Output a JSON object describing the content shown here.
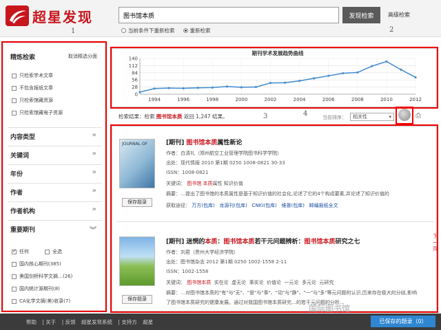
{
  "header": {
    "logo_text": "超星发现",
    "search_value": "图书馆本质",
    "search_button": "发现检索",
    "advanced_link": "高级检索",
    "radio_options": [
      {
        "label": "当前条件下重新检索",
        "checked": false
      },
      {
        "label": "重新检索",
        "checked": true
      }
    ]
  },
  "annotations": [
    "1",
    "2",
    "3",
    "4"
  ],
  "sidebar": {
    "title": "精炼检索",
    "cancel": "取消精选分面",
    "options": [
      "只检索学术文章",
      "不包含报纸文章",
      "只检索馆藏资源",
      "只检索馆藏电子资源"
    ],
    "sections": [
      "内容类型",
      "关键词",
      "年份",
      "作者",
      "作者机构"
    ],
    "core_journals": {
      "title": "重要期刊",
      "any": "任何",
      "all": "全选",
      "items": [
        "国内核心期刊(385)",
        "美国剑桥科学文摘…(26)",
        "国内统计源期刊(8)",
        "CA化学文摘(美)收录(7)"
      ]
    }
  },
  "chart_data": {
    "type": "line",
    "title": "期刊学术发展趋势曲线",
    "x": [
      1993,
      1994,
      1995,
      1996,
      1997,
      1998,
      1999,
      2000,
      2001,
      2002,
      2003,
      2004,
      2005,
      2006,
      2007,
      2008,
      2009,
      2010,
      2011,
      2012
    ],
    "series": [
      {
        "values": [
          8,
          22,
          24,
          23,
          25,
          26,
          30,
          27,
          28,
          44,
          45,
          52,
          62,
          72,
          82,
          85,
          110,
          128,
          96,
          66
        ]
      }
    ],
    "yticks": [
      0,
      28,
      56,
      84,
      112,
      140
    ],
    "xticks": [
      "1994",
      "1996",
      "1998",
      "2000",
      "2002",
      "2004",
      "2006",
      "2008",
      "2010",
      "2012"
    ],
    "ylim": [
      0,
      140
    ],
    "grid": true,
    "color": "#4a90d0"
  },
  "results": {
    "prefix": "检索结果：检索",
    "keyword": "图书馆本质",
    "count_text": "返回 1,247 结果",
    "suffix": "。",
    "sort_label": "当前排序：",
    "sort_value": "相关性"
  },
  "items": [
    {
      "type": "[期刊]",
      "title_hl": "图书馆本质",
      "title_rest": "属性新论",
      "author": "作者：白清礼（郑州航空工业管理学院图书科学学院）",
      "source": "出处：现代情报 2010 第1期 0250 1008-0821 30-33",
      "issn": "ISSN：1008-0821",
      "kw_label": "关键词：",
      "keywords": [
        "图书馆",
        "本质",
        "属性",
        "知识价值"
      ],
      "abstract": "摘要：…提出了图书馆的本质属性是基于知识价值的社会化,论述了它的4个构成要素,并论述了知识价值的",
      "holdings_label": "获取途径：",
      "holdings": [
        "万方(包库)",
        "龙源刊(包库)",
        "CNKI(包库)",
        "维普(包库)",
        "邮编报纸全文"
      ],
      "save": "保存题录"
    },
    {
      "type": "[期刊]",
      "title_pre": "迷惘的",
      "title_hl1": "本质",
      "title_mid1": "：",
      "title_hl2": "图书馆本质",
      "title_mid2": "若干元问题辨析：",
      "title_hl3": "图书馆本质",
      "title_rest": "研究之七",
      "author": "作者：刘君（贵州大学经济学院）",
      "source": "出处：图书馆杂志 2012 第1期 0250 1002-1558 2-11",
      "issn": "ISSN：1002-1558",
      "kw_label": "关键词：",
      "keywords": [
        "图书馆本质",
        "实在论",
        "虚无论",
        "事实论",
        "价值论",
        "一元论",
        "多元论",
        "元研究"
      ],
      "abstract": "摘要：…对图书馆本质的\"有\"与\"无\"、\"是\"与\"事\"、\"动\"与\"静\"、\"一\"与\"多\"等元问题的认识,历来存在极大的分歧,影响",
      "abstract2": "了图书馆本质研究的健康发展。通过对我国图书馆本质研究…的若干元问题的分析…",
      "save": "保存题录"
    }
  ],
  "side_label": "下一页",
  "footer": {
    "links": [
      "帮助",
      "| 关于",
      "| 反馈",
      "超星发现系统",
      "| 支持方",
      "超星"
    ],
    "saved_button": "已保存的题录（0）"
  },
  "watermark": "国际图书馆"
}
